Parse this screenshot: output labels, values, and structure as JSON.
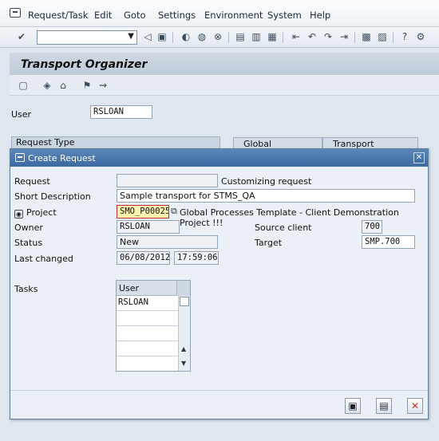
{
  "menubar": {
    "items": [
      "Request/Task",
      "Edit",
      "Goto",
      "Settings",
      "Environment",
      "System",
      "Help"
    ]
  },
  "toolbar": {
    "command_field": "",
    "icons": [
      "enter-icon",
      "back-icon",
      "save-icon",
      "nav-back-icon",
      "nav-exit-icon",
      "cancel-icon",
      "print-icon",
      "find-icon",
      "find-next-icon",
      "first-page-icon",
      "prev-page-icon",
      "next-page-icon",
      "last-page-icon",
      "new-session-icon",
      "shortcut-icon",
      "help-icon",
      "layout-icon"
    ]
  },
  "page": {
    "title": "Transport Organizer",
    "user_label": "User",
    "user_value": "RSLOAN",
    "request_type_label": "Request Type",
    "tabs": [
      "Global Information",
      "Transport Proposals"
    ]
  },
  "dialog": {
    "title": "Create Request",
    "request_label": "Request",
    "request_value": "",
    "request_type_text": "Customizing request",
    "short_desc_label": "Short Description",
    "short_desc_value": "Sample transport for STMS_QA",
    "project_label": "Project",
    "project_value": "SMO_P00025",
    "project_desc": "Global Processes Template - Client Demonstration Project !!!",
    "owner_label": "Owner",
    "owner_value": "RSLOAN",
    "source_client_label": "Source client",
    "source_client_value": "700",
    "status_label": "Status",
    "status_value": "New",
    "target_label": "Target",
    "target_value": "SMP.700",
    "last_changed_label": "Last changed",
    "last_changed_date": "06/08/2012",
    "last_changed_time": "17:59:06",
    "tasks_label": "Tasks",
    "tasks_header": "User",
    "tasks_rows": [
      "RSLOAN",
      "",
      "",
      "",
      ""
    ]
  },
  "colors": {
    "dialog_title_bg": "#3b6aa2",
    "project_highlight": "#fff3b0",
    "close_button": "#c0392b"
  }
}
